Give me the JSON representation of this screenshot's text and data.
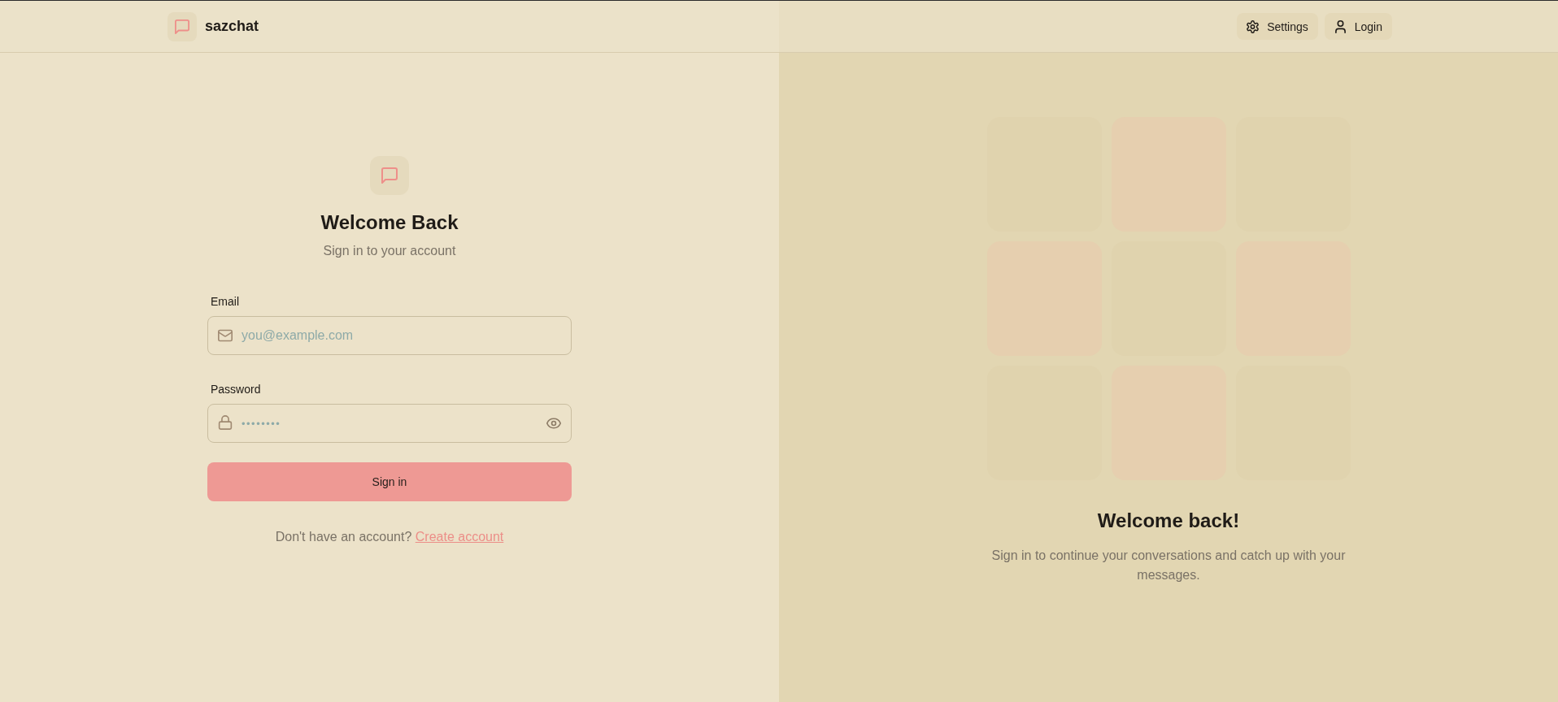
{
  "header": {
    "brand": "sazchat",
    "buttons": [
      {
        "kind": "settings",
        "label": "Settings"
      },
      {
        "kind": "login",
        "label": "Login"
      }
    ]
  },
  "login_form": {
    "title": "Welcome Back",
    "subtitle": "Sign in to your account",
    "fields": [
      {
        "kind": "email",
        "label": "Email",
        "placeholder": "you@example.com"
      },
      {
        "kind": "password",
        "label": "Password",
        "placeholder": "••••••••"
      }
    ],
    "submit": "Sign in",
    "footer_text": "Don't have an account?",
    "footer_link": "Create account"
  },
  "side_panel": {
    "tiles": [
      {
        "color": "#e0d3ae"
      },
      {
        "color": "#e6cfaf"
      },
      {
        "color": "#e0d3ae"
      },
      {
        "color": "#e6cfaf"
      },
      {
        "color": "#e0d3ae"
      },
      {
        "color": "#e6cfaf"
      },
      {
        "color": "#e0d3ae"
      },
      {
        "color": "#e6cfaf"
      },
      {
        "color": "#e0d3ae"
      }
    ],
    "title": "Welcome back!",
    "text": "Sign in to continue your conversations and catch up with your messages."
  }
}
